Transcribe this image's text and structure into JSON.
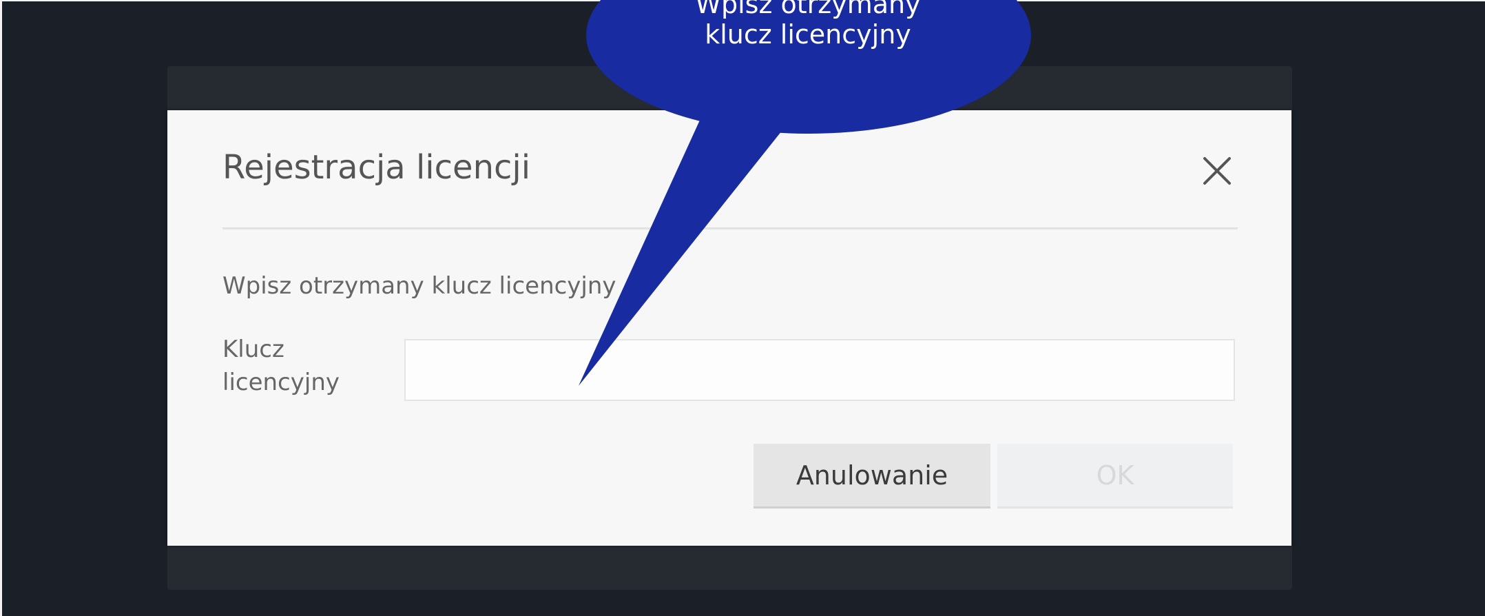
{
  "dialog": {
    "title": "Rejestracja licencji",
    "instruction": "Wpisz otrzymany klucz licencyjny",
    "field_label": "Klucz licencyjny",
    "field_value": "",
    "cancel_label": "Anulowanie",
    "ok_label": "OK",
    "close_icon": "close-icon"
  },
  "callout": {
    "line1": "Wpisz otrzymany",
    "line2": "klucz licencyjny",
    "color": "#182ba0"
  },
  "colors": {
    "background": "#1b1f27",
    "dialog": "#f7f7f7",
    "cancel_button": "#e5e5e5",
    "ok_button_disabled": "#eef0f2"
  }
}
